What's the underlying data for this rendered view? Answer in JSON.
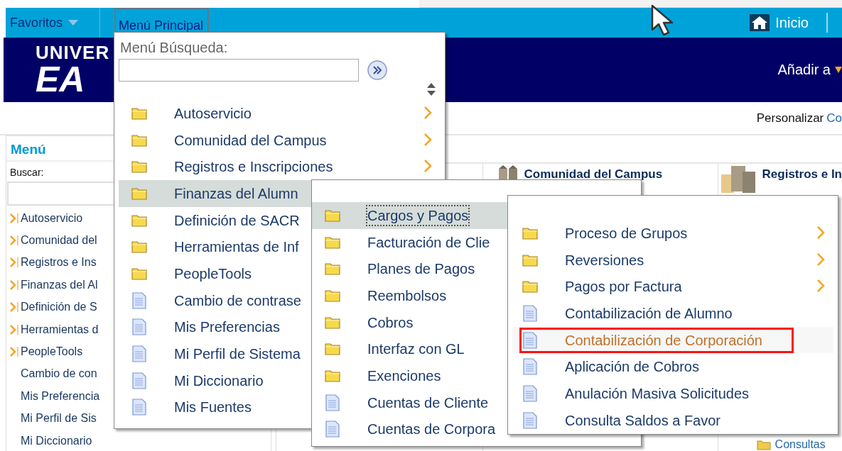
{
  "nav": {
    "favorites": "Favoritos",
    "main_menu": {
      "label": "Menú Principal",
      "selected": true
    },
    "home": "Inicio"
  },
  "header": {
    "logo_lines": [
      "UNIVER",
      "EA"
    ],
    "add_to": "Añadir a"
  },
  "personalize": {
    "label": "Personalizar",
    "link": "Co"
  },
  "left_menu": {
    "title": "Menú",
    "search_label": "Buscar:",
    "items": [
      {
        "label": "Autoservicio",
        "kind": "folder"
      },
      {
        "label": "Comunidad del",
        "kind": "folder"
      },
      {
        "label": "Registros e Ins",
        "kind": "folder"
      },
      {
        "label": "Finanzas del Al",
        "kind": "folder"
      },
      {
        "label": "Definición de S",
        "kind": "folder"
      },
      {
        "label": "Herramientas d",
        "kind": "folder"
      },
      {
        "label": "PeopleTools",
        "kind": "folder"
      },
      {
        "label": "Cambio de con",
        "kind": "page"
      },
      {
        "label": "Mis Preferencia",
        "kind": "page"
      },
      {
        "label": "Mi Perfil de Sis",
        "kind": "page"
      },
      {
        "label": "Mi Diccionario",
        "kind": "page"
      }
    ]
  },
  "pagelets": [
    {
      "title": "Comunidad del Campus"
    },
    {
      "title": "Registros e In"
    }
  ],
  "pagelet_link": "Consultas",
  "menu_search": {
    "label": "Menú Búsqueda:"
  },
  "menus": [
    {
      "items": [
        {
          "label": "Autoservicio",
          "kind": "folder",
          "selected": false,
          "arrow": true
        },
        {
          "label": "Comunidad del Campus",
          "kind": "folder",
          "selected": false,
          "arrow": true
        },
        {
          "label": "Registros e Inscripciones",
          "kind": "folder",
          "selected": false,
          "arrow": true
        },
        {
          "label": "Finanzas del Alumn",
          "kind": "folder",
          "selected": true,
          "arrow": false
        },
        {
          "label": "Definición de SACR",
          "kind": "folder",
          "selected": false,
          "arrow": false
        },
        {
          "label": "Herramientas de Inf",
          "kind": "folder",
          "selected": false,
          "arrow": false
        },
        {
          "label": "PeopleTools",
          "kind": "folder",
          "selected": false,
          "arrow": false
        },
        {
          "label": "Cambio de contrase",
          "kind": "page",
          "selected": false,
          "arrow": false
        },
        {
          "label": "Mis Preferencias",
          "kind": "page",
          "selected": false,
          "arrow": false
        },
        {
          "label": "Mi Perfil de Sistema",
          "kind": "page",
          "selected": false,
          "arrow": false
        },
        {
          "label": "Mi Diccionario",
          "kind": "page",
          "selected": false,
          "arrow": false
        },
        {
          "label": "Mis Fuentes",
          "kind": "page",
          "selected": false,
          "arrow": false
        }
      ]
    },
    {
      "items": [
        {
          "label": "Cargos y Pagos",
          "kind": "folder",
          "selected": true,
          "focused": true,
          "arrow": false
        },
        {
          "label": "Facturación de Clie",
          "kind": "folder",
          "selected": false,
          "focused": false,
          "arrow": false
        },
        {
          "label": "Planes de Pagos",
          "kind": "folder",
          "selected": false,
          "focused": false,
          "arrow": false
        },
        {
          "label": "Reembolsos",
          "kind": "folder",
          "selected": false,
          "focused": false,
          "arrow": false
        },
        {
          "label": "Cobros",
          "kind": "folder",
          "selected": false,
          "focused": false,
          "arrow": false
        },
        {
          "label": "Interfaz con GL",
          "kind": "folder",
          "selected": false,
          "focused": false,
          "arrow": false
        },
        {
          "label": "Exenciones",
          "kind": "folder",
          "selected": false,
          "focused": false,
          "arrow": false
        },
        {
          "label": "Cuentas de Cliente",
          "kind": "page",
          "selected": false,
          "focused": false,
          "arrow": false
        },
        {
          "label": "Cuentas de Corpora",
          "kind": "page",
          "selected": false,
          "focused": false,
          "arrow": false
        }
      ]
    },
    {
      "items": [
        {
          "label": "Proceso de Grupos",
          "kind": "folder",
          "selected": false,
          "annotated": false,
          "arrow": true
        },
        {
          "label": "Reversiones",
          "kind": "folder",
          "selected": false,
          "annotated": false,
          "arrow": true
        },
        {
          "label": "Pagos por Factura",
          "kind": "folder",
          "selected": false,
          "annotated": false,
          "arrow": true
        },
        {
          "label": "Contabilización de Alumno",
          "kind": "page",
          "selected": false,
          "annotated": false,
          "arrow": false
        },
        {
          "label": "Contabilización de Corporación",
          "kind": "page",
          "selected": true,
          "annotated": true,
          "arrow": false
        },
        {
          "label": "Aplicación de Cobros",
          "kind": "page",
          "selected": false,
          "annotated": false,
          "arrow": false
        },
        {
          "label": "Anulación Masiva Solicitudes",
          "kind": "page",
          "selected": false,
          "annotated": false,
          "arrow": false
        },
        {
          "label": "Consulta Saldos a Favor",
          "kind": "page",
          "selected": false,
          "annotated": false,
          "arrow": false
        }
      ]
    }
  ]
}
